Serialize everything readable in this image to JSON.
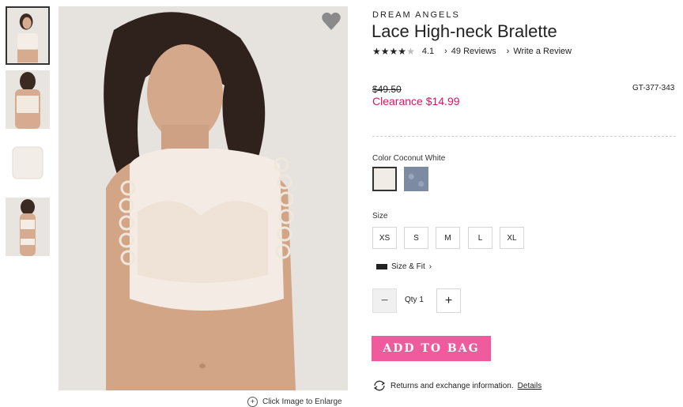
{
  "product": {
    "brand": "DREAM ANGELS",
    "title": "Lace High-neck Bralette",
    "rating_value": "4.1",
    "rating_stars": 4,
    "reviews_link": "49 Reviews",
    "write_review_link": "Write a Review",
    "original_price": "$49.50",
    "sku": "GT-377-343",
    "clearance_price": "Clearance $14.99"
  },
  "color": {
    "label": "Color Coconut White",
    "swatches": [
      {
        "name": "Coconut White",
        "hex": "#f1ede6"
      },
      {
        "name": "Blue",
        "hex": "#7c8ba2"
      }
    ]
  },
  "size": {
    "label": "Size",
    "options": [
      "XS",
      "S",
      "M",
      "L",
      "XL"
    ],
    "fit_link": "Size & Fit"
  },
  "quantity": {
    "label": "Qty 1",
    "minus": "−",
    "plus": "+"
  },
  "actions": {
    "add_to_bag": "ADD TO BAG",
    "enlarge": "Click Image to Enlarge",
    "returns_text": "Returns and exchange information.",
    "details_link": "Details"
  },
  "colors": {
    "accent": "#ef5b9c",
    "clearance": "#d3195f"
  },
  "icons": [
    "heart-icon",
    "zoom-icon",
    "ruler-icon",
    "returns-icon",
    "star-icon"
  ]
}
